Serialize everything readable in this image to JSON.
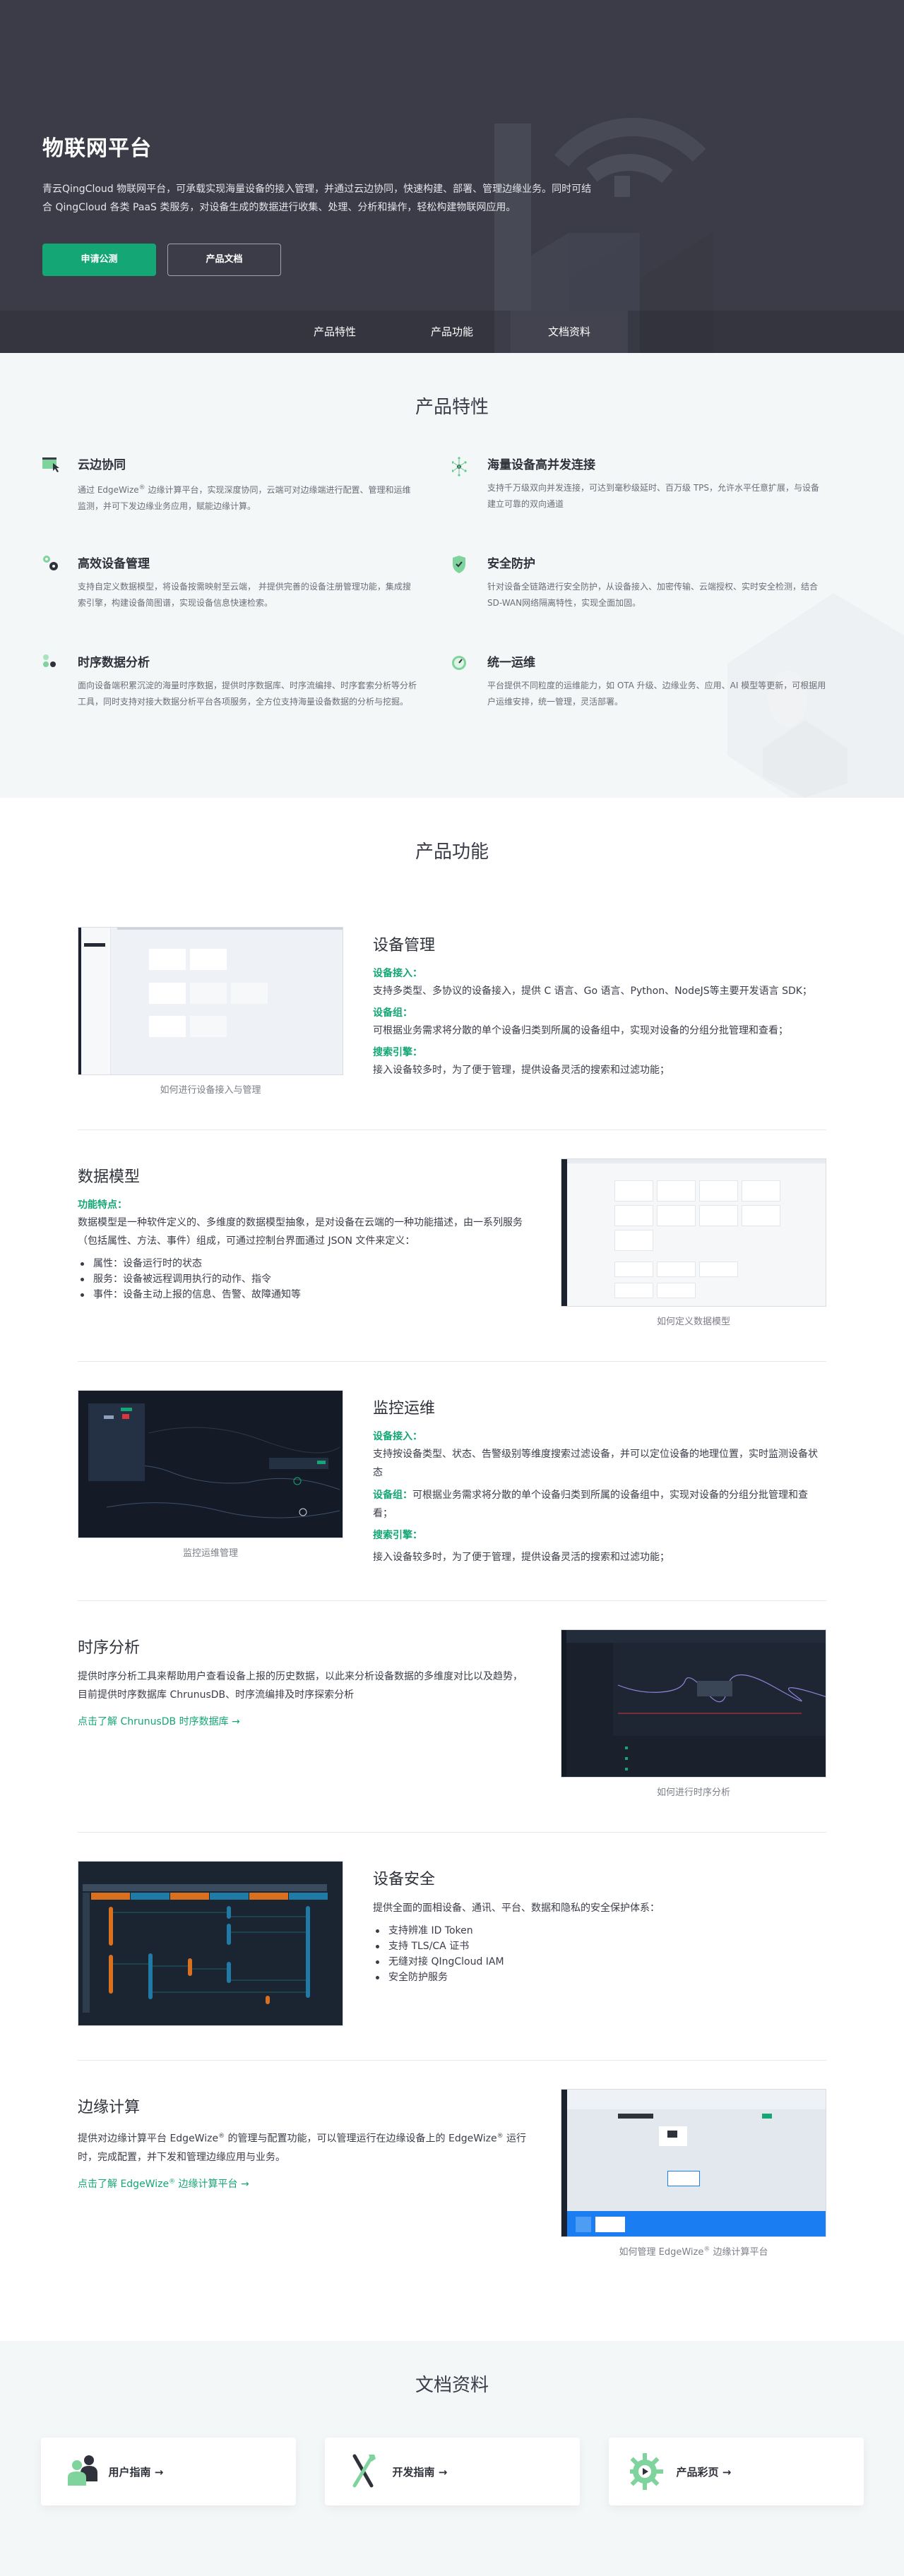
{
  "hero": {
    "title": "物联网平台",
    "description": "青云QingCloud 物联网平台，可承载实现海量设备的接入管理，并通过云边协同，快速构建、部署、管理边缘业务。同时可结合 QingCloud 各类 PaaS 类服务，对设备生成的数据进行收集、处理、分析和操作，轻松构建物联网应用。",
    "primary_button": "申请公测",
    "secondary_button": "产品文档",
    "nav": [
      {
        "label": "产品特性"
      },
      {
        "label": "产品功能"
      },
      {
        "label": "文档资料"
      }
    ]
  },
  "features": {
    "title": "产品特性",
    "items": [
      {
        "title": "云边协同",
        "desc_pre": "通过 EdgeWize",
        "desc_post": " 边缘计算平台，实现深度协同，云端可对边缘端进行配置、管理和运维监测，并可下发边缘业务应用，赋能边缘计算。",
        "icon": "window-cursor-icon"
      },
      {
        "title": "海量设备高并发连接",
        "desc": "支持千万级双向并发连接，可达到毫秒级延时、百万级 TPS，允许水平任意扩展，与设备建立可靠的双向通道",
        "icon": "network-hub-icon"
      },
      {
        "title": "高效设备管理",
        "desc": "支持自定义数据模型，将设备按需映射至云端， 并提供完善的设备注册管理功能，集成搜索引擎，构建设备简图谱，实现设备信息快速检索。",
        "icon": "gears-icon"
      },
      {
        "title": "安全防护",
        "desc": "针对设备全链路进行安全防护，从设备接入、加密传输、云端授权、实时安全检测，结合SD-WAN网络隔离特性，实现全面加固。",
        "icon": "shield-check-icon"
      },
      {
        "title": "时序数据分析",
        "desc": "面向设备端积累沉淀的海量时序数据，提供时序数据库、时序流编排、时序套索分析等分析工具，同时支持对接大数据分析平台各项服务，全方位支持海量设备数据的分析与挖掘。",
        "icon": "dots-grid-icon"
      },
      {
        "title": "统一运维",
        "desc": "平台提供不同粒度的运维能力，如 OTA 升级、边缘业务、应用、AI 模型等更新，可根据用户运维安排，统一管理，灵活部署。",
        "icon": "gauge-icon"
      }
    ]
  },
  "functions": {
    "title": "产品功能",
    "device_mgmt": {
      "title": "设备管理",
      "caption": "如何进行设备接入与管理",
      "blocks": [
        {
          "label": "设备接入：",
          "text": "支持多类型、多协议的设备接入，提供 C 语言、Go 语言、Python、NodeJS等主要开发语言 SDK；"
        },
        {
          "label": "设备组：",
          "text": "可根据业务需求将分散的单个设备归类到所属的设备组中，实现对设备的分组分批管理和查看；"
        },
        {
          "label": "搜索引擎：",
          "text": "接入设备较多时，为了便于管理，提供设备灵活的搜索和过滤功能；"
        }
      ]
    },
    "data_model": {
      "title": "数据模型",
      "caption": "如何定义数据模型",
      "label": "功能特点：",
      "text": "数据模型是一种软件定义的、多维度的数据模型抽象，是对设备在云端的一种功能描述，由一系列服务（包括属性、方法、事件）组成，可通过控制台界面通过 JSON 文件来定义：",
      "list": [
        "属性：设备运行时的状态",
        "服务：设备被远程调用执行的动作、指令",
        "事件：设备主动上报的信息、告警、故障通知等"
      ]
    },
    "monitoring": {
      "title": "监控运维",
      "caption": "监控运维管理",
      "block1_label": "设备接入：",
      "block1_text": "支持按设备类型、状态、告警级别等维度搜索过滤设备，并可以定位设备的地理位置，实时监测设备状态",
      "block2_label": "设备组：",
      "block2_text": "可根据业务需求将分散的单个设备归类到所属的设备组中，实现对设备的分组分批管理和查看；",
      "block3_label": "搜索引擎：",
      "block3_text": "接入设备较多时，为了便于管理，提供设备灵活的搜索和过滤功能；"
    },
    "timeseries": {
      "title": "时序分析",
      "caption": "如何进行时序分析",
      "text": "提供时序分析工具来帮助用户查看设备上报的历史数据，以此来分析设备数据的多维度对比以及趋势，目前提供时序数据库 ChrunusDB、时序流编排及时序探索分析",
      "link": "点击了解 ChrunusDB 时序数据库 →"
    },
    "security": {
      "title": "设备安全",
      "text": "提供全面的面相设备、通讯、平台、数据和隐私的安全保护体系：",
      "list": [
        "支持辨准 ID Token",
        "支持 TLS/CA 证书",
        "无缝对接 QIngCloud IAM",
        "安全防护服务"
      ]
    },
    "edge": {
      "title": "边缘计算",
      "caption_pre": "如何管理 EdgeWize",
      "caption_post": " 边缘计算平台",
      "text_pre": "提供对边缘计算平台 EdgeWize",
      "text_mid": " 的管理与配置功能，可以管理运行在边缘设备上的 EdgeWize",
      "text_post": " 运行时，完成配置，并下发和管理边缘应用与业务。",
      "link_pre": "点击了解 EdgeWize",
      "link_post": " 边缘计算平台 →",
      "reg": "®"
    }
  },
  "docs": {
    "title": "文档资料",
    "cards": [
      {
        "label": "用户指南 →",
        "icon": "users-icon"
      },
      {
        "label": "开发指南 →",
        "icon": "tools-icon"
      },
      {
        "label": "产品彩页 →",
        "icon": "gear-play-icon"
      }
    ]
  },
  "colors": {
    "brand_green": "#15a675",
    "hero_bg": "#3b3c47",
    "light_bg": "#f4f7f8"
  }
}
